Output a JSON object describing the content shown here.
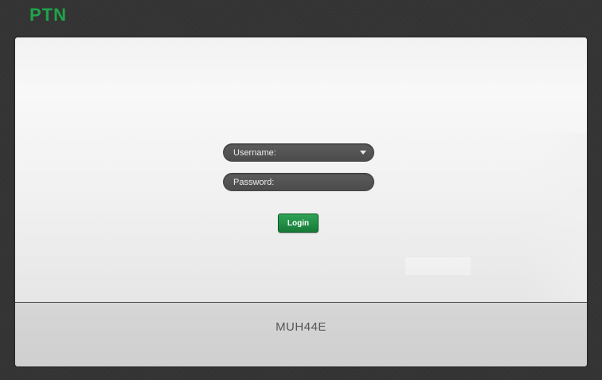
{
  "brand": {
    "logo_text": "PTN",
    "logo_color": "#1fa34a"
  },
  "login_form": {
    "username_label": "Username:",
    "password_label": "Password:",
    "login_label": "Login",
    "dropdown_icon": "chevron-down-icon"
  },
  "footer": {
    "model": "MUH44E"
  },
  "colors": {
    "accent": "#1fa34a",
    "button": "#167a37",
    "field_bg": "#4b4b4b"
  }
}
